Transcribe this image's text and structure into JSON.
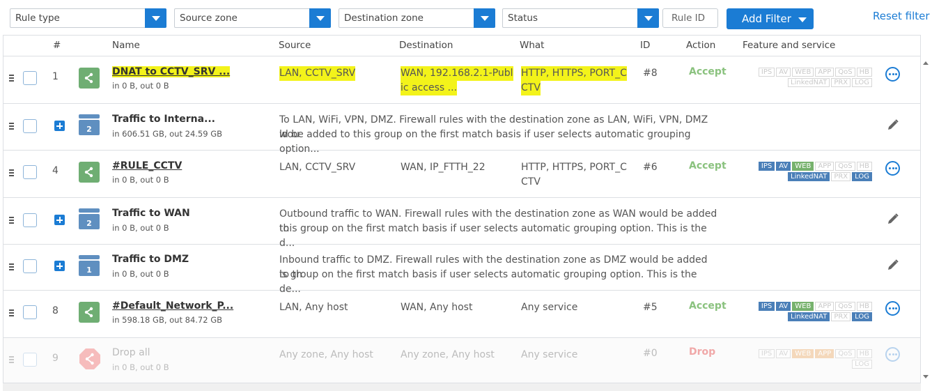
{
  "filters": {
    "rule_type": "Rule type",
    "source_zone": "Source zone",
    "destination_zone": "Destination zone",
    "status": "Status",
    "rule_id_placeholder": "Rule ID",
    "add_filter": "Add Filter",
    "reset_filter": "Reset filter"
  },
  "columns": {
    "hash": "#",
    "name": "Name",
    "source": "Source",
    "destination": "Destination",
    "what": "What",
    "id": "ID",
    "action": "Action",
    "feature": "Feature and service"
  },
  "rows": [
    {
      "num": "1",
      "name": "DNAT to CCTV_SRV ...",
      "traffic": "in 0 B, out 0 B",
      "source": "LAN, CCTV_SRV",
      "dest_1": "WAN, 192.168.2.1-Publ",
      "dest_2": "ic access ...",
      "what_1": "HTTP, HTTPS, PORT_C",
      "what_2": "CTV",
      "id": "#8",
      "action": "Accept"
    },
    {
      "name": "Traffic to Interna...",
      "traffic": "in 606.51 GB, out 24.59 GB",
      "group_count": "2",
      "desc_1": "To LAN, WiFi, VPN, DMZ. Firewall rules with the destination zone as LAN, WiFi, VPN, DMZ wou",
      "desc_2": "ld be added to this group on the first match basis if user selects automatic grouping option..."
    },
    {
      "num": "4",
      "name": "#RULE_CCTV",
      "traffic": "in 0 B, out 0 B",
      "source": "LAN, CCTV_SRV",
      "dest_1": "WAN, IP_FTTH_22",
      "what_1": "HTTP, HTTPS, PORT_C",
      "what_2": "CTV",
      "id": "#6",
      "action": "Accept"
    },
    {
      "name": "Traffic to WAN",
      "traffic": "in 0 B, out 0 B",
      "group_count": "2",
      "desc_1": "Outbound traffic to WAN. Firewall rules with the destination zone as WAN would be added to",
      "desc_2": "this group on the first match basis if user selects automatic grouping option. This is the d..."
    },
    {
      "name": "Traffic to DMZ",
      "traffic": "in 0 B, out 0 B",
      "group_count": "1",
      "desc_1": "Inbound traffic to DMZ. Firewall rules with the destination zone as DMZ would be added to th",
      "desc_2": "is group on the first match basis if user selects automatic grouping option. This is the de..."
    },
    {
      "num": "8",
      "name": "#Default_Network_P...",
      "traffic": "in 598.18 GB, out 84.72 GB",
      "source": "LAN, Any host",
      "dest_1": "WAN, Any host",
      "what_1": "Any service",
      "id": "#5",
      "action": "Accept"
    },
    {
      "num": "9",
      "name": "Drop all",
      "traffic": "in 0 B, out 0 B",
      "source": "Any zone, Any host",
      "dest_1": "Any zone, Any host",
      "what_1": "Any service",
      "id": "#0",
      "action": "Drop"
    }
  ],
  "badges": {
    "ips": "IPS",
    "av": "AV",
    "web": "WEB",
    "app": "APP",
    "qos": "QoS",
    "hb": "HB",
    "linkednat": "LinkedNAT",
    "prx": "PRX",
    "log": "LOG"
  },
  "colors": {
    "accent": "#1b7cd4",
    "accept": "#8ac27e",
    "highlight": "#f3f31a",
    "rule_icon": "#6fae73"
  }
}
